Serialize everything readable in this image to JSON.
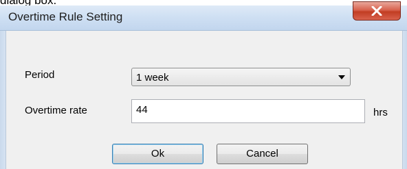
{
  "caption": "dialog box.",
  "dialog": {
    "title": "Overtime Rule Setting",
    "close_label": "X"
  },
  "form": {
    "period_label": "Period",
    "period_value": "1 week",
    "overtime_rate_label": "Overtime rate",
    "overtime_rate_value": "44",
    "unit": "hrs"
  },
  "buttons": {
    "ok": "Ok",
    "cancel": "Cancel"
  }
}
